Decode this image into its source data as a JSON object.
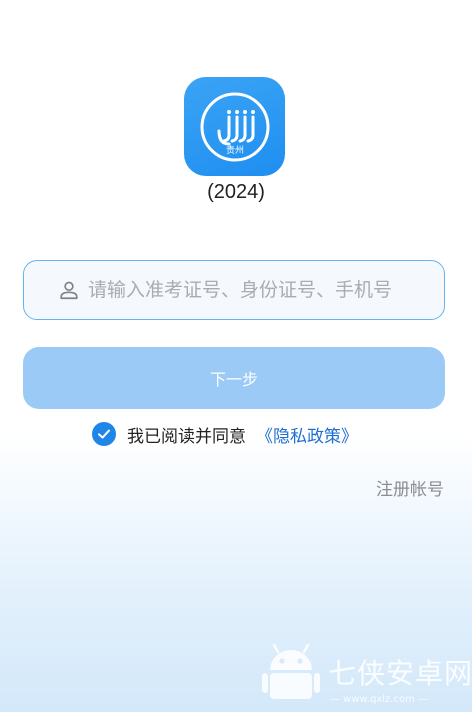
{
  "app": {
    "icon_name": "guizhou-app-logo-icon",
    "icon_text": "贵州",
    "year_label": "(2024)"
  },
  "login": {
    "id_field": {
      "value": "",
      "placeholder": "请输入准考证号、身份证号、手机号",
      "icon": "user-icon"
    },
    "next_label": "下一步",
    "agreement": {
      "checked": true,
      "text": "我已阅读并同意",
      "policy_link": "《隐私政策》"
    },
    "register_label": "注册帐号"
  },
  "watermark": {
    "title": "七侠安卓网",
    "url": "— www.qxlz.com —"
  },
  "colors": {
    "accent": "#1f86e8",
    "button_disabled": "#9ccaf6",
    "field_border": "#62b5f2",
    "link": "#1f6fd4"
  }
}
